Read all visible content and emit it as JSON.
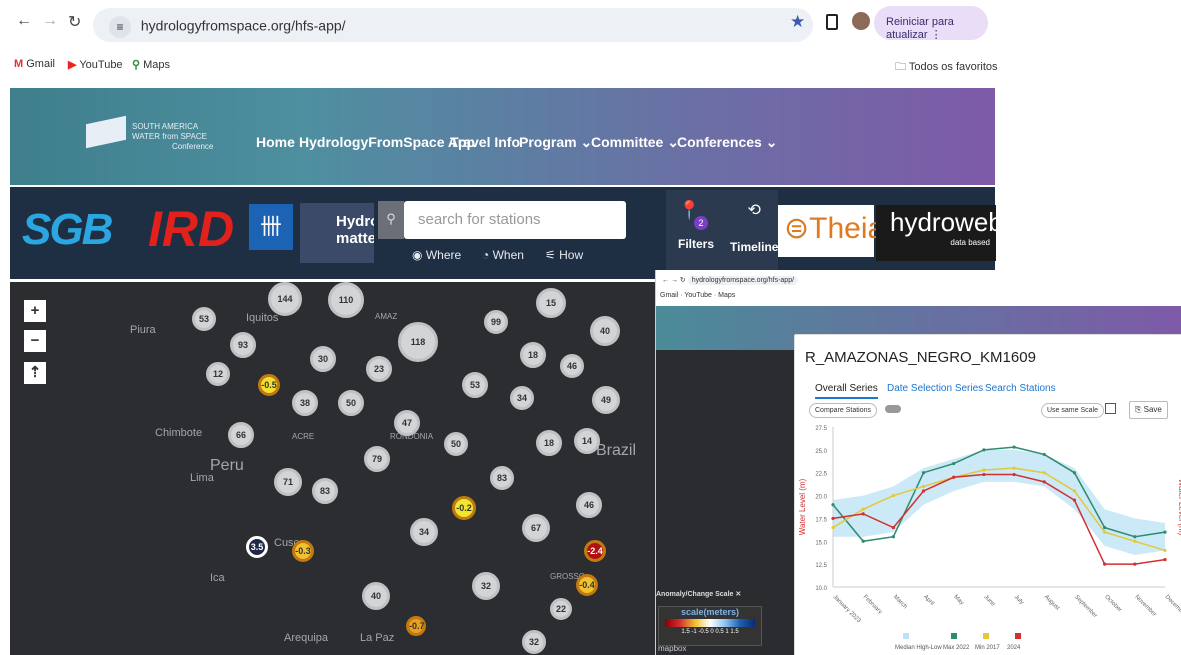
{
  "browser": {
    "url": "hydrologyfromspace.org/hfs-app/",
    "update_button": "Reiniciar para atualizar",
    "bookmarks": [
      "Gmail",
      "YouTube",
      "Maps"
    ],
    "all_bookmarks": "Todos os favoritos"
  },
  "site": {
    "logo_lines": [
      "SOUTH AMERICA",
      "WATER from SPACE",
      "Conference"
    ],
    "nav": [
      "Home",
      "HydrologyFromSpace App",
      "Travel Info",
      "Program",
      "Committee",
      "Conferences"
    ],
    "partner_logos": [
      "SGB",
      "IRD",
      "Hydro matters",
      "Theia",
      "hydroweb",
      "data based"
    ],
    "search_placeholder": "search for stations",
    "search_links": [
      "Where",
      "When",
      "How"
    ],
    "filters_label": "Filters",
    "filters_badge": "2",
    "timeline_label": "Timeline"
  },
  "map": {
    "places": [
      "Piura",
      "Iquitos",
      "Chimbote",
      "Peru",
      "Lima",
      "Cusco",
      "Ica",
      "Arequipa",
      "La Paz",
      "Brazil",
      "ACRE",
      "RONDONIA",
      "AMAZ",
      "GROSSO"
    ],
    "clusters": [
      "53",
      "93",
      "12",
      "66",
      "71",
      "83",
      "79",
      "38",
      "50",
      "30",
      "23",
      "118",
      "110",
      "144",
      "99",
      "15",
      "40",
      "18",
      "46",
      "53",
      "34",
      "49",
      "47",
      "50",
      "18",
      "14",
      "83",
      "67",
      "46",
      "22",
      "32",
      "40",
      "34",
      "32",
      "3.5",
      "-0.3",
      "-0.5",
      "-0.2",
      "-2.4",
      "-0.4",
      "-0.7"
    ]
  },
  "overlay": {
    "url": "hydrologyfromspace.org/hfs-app/",
    "bookmarks": [
      "Gmail",
      "YouTube",
      "Maps"
    ],
    "scale_title": "Anomaly/Change Scale",
    "scale_label": "scale(meters)",
    "scale_ticks": "1.5 -1 -0.5 0 0.5 1 1.5",
    "mapbox": "mapbox",
    "station_title": "R_AMAZONAS_NEGRO_KM1609",
    "tabs": [
      "Overall Series",
      "Date Selection Series",
      "Search Stations"
    ],
    "compare_button": "Compare Stations",
    "same_scale_button": "Use same Scale",
    "save_button": "Save"
  },
  "chart_data": {
    "type": "line",
    "xlabel": "",
    "ylabel": "Water Level (m)",
    "y2label": "Water Level (m)",
    "ylim": [
      10.0,
      27.5
    ],
    "yticks": [
      10.0,
      12.5,
      15.0,
      17.5,
      20.0,
      22.5,
      25.0,
      27.5
    ],
    "categories": [
      "January 2023",
      "February",
      "March",
      "April",
      "May",
      "June",
      "July",
      "August",
      "September",
      "October",
      "November",
      "December"
    ],
    "legend": [
      "Median High-Low",
      "Max 2022",
      "Min 2017",
      "2024"
    ],
    "series": [
      {
        "name": "Max 2022",
        "color": "#2e8b6d",
        "values": [
          19.0,
          15.0,
          15.5,
          22.5,
          23.5,
          25.0,
          25.3,
          24.5,
          22.5,
          16.5,
          15.5,
          16.0
        ]
      },
      {
        "name": "Min 2017",
        "color": "#e0c93a",
        "values": [
          16.5,
          18.5,
          20.0,
          21.0,
          22.0,
          22.8,
          23.0,
          22.5,
          20.5,
          16.0,
          15.0,
          14.0
        ]
      },
      {
        "name": "2024",
        "color": "#d32f2f",
        "values": [
          17.5,
          18.0,
          16.5,
          20.5,
          22.0,
          22.3,
          22.3,
          21.5,
          19.5,
          12.5,
          12.5,
          13.0
        ]
      }
    ],
    "band": {
      "name": "Median High-Low",
      "color": "#bfe3f5",
      "high": [
        19.5,
        20.0,
        21.0,
        23.0,
        24.0,
        25.0,
        25.0,
        24.5,
        23.0,
        18.5,
        17.5,
        17.0
      ],
      "low": [
        15.5,
        15.5,
        16.0,
        19.0,
        20.5,
        21.5,
        21.5,
        21.0,
        18.5,
        14.5,
        13.5,
        14.0
      ]
    }
  }
}
